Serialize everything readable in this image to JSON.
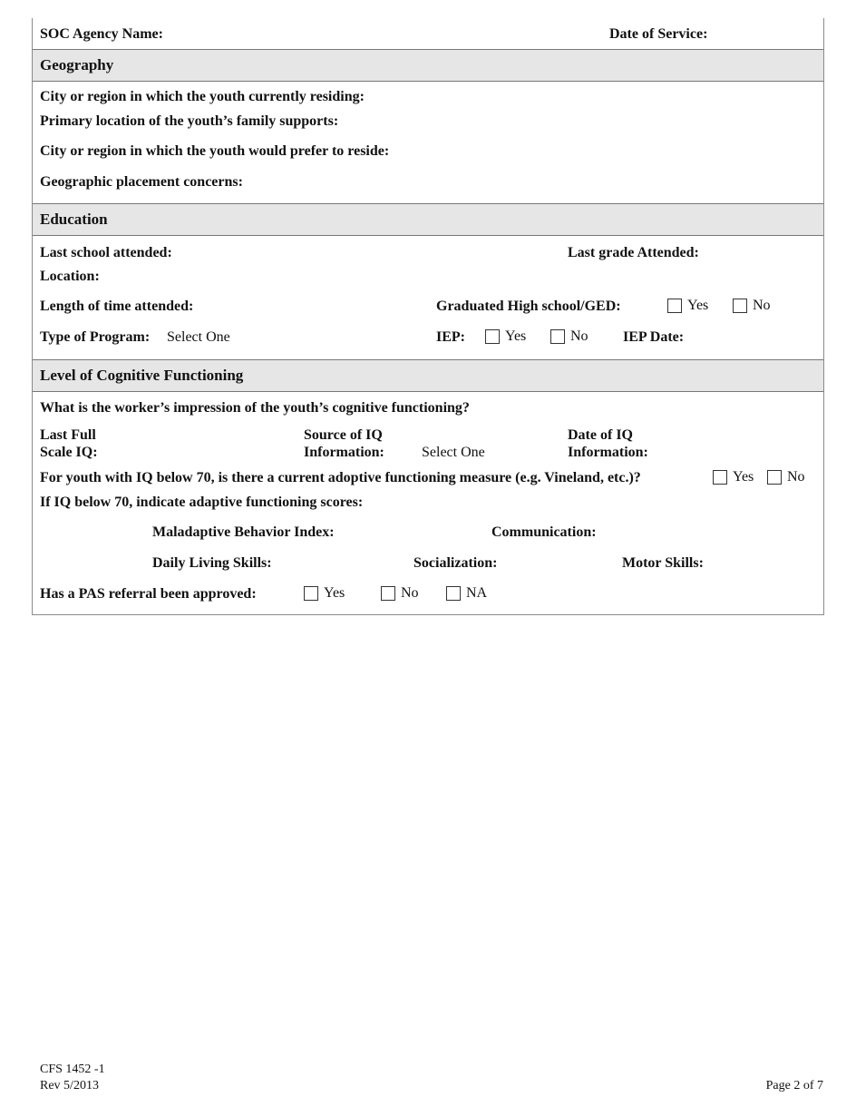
{
  "header": {
    "agency_label": "SOC Agency Name:",
    "date_label": "Date of Service:"
  },
  "geography": {
    "title": "Geography",
    "current_city": "City or region in which the youth currently residing:",
    "family_supports": "Primary location of the youth’s family supports:",
    "preferred_city": "City or region in which the youth would prefer to reside:",
    "placement_concerns": "Geographic placement concerns:"
  },
  "education": {
    "title": "Education",
    "last_school": "Last school attended:",
    "last_grade": "Last grade Attended:",
    "location": "Location:",
    "length_time": "Length of time attended:",
    "graduated": "Graduated High school/GED:",
    "graduated_options": [
      "Yes",
      "No"
    ],
    "program_label": "Type of Program:",
    "program_value": "Select One",
    "iep_label": "IEP:",
    "iep_options": [
      "Yes",
      "No"
    ],
    "iep_date": "IEP Date:"
  },
  "cognitive": {
    "title": "Level of Cognitive Functioning",
    "impression": "What is the worker’s impression of the youth’s cognitive functioning?",
    "full_scale_1": "Last Full",
    "full_scale_2": "Scale IQ:",
    "source_1": "Source of IQ",
    "source_2": "Information:",
    "source_value": "Select One",
    "date_1": "Date of IQ",
    "date_2": "Information:",
    "adaptive_question": "For youth with IQ below 70, is there a current adoptive functioning measure (e.g. Vineland, etc.)?",
    "adaptive_options": [
      "Yes",
      "No"
    ],
    "scores_label": "If IQ below 70, indicate adaptive functioning scores:",
    "maladaptive": "Maladaptive Behavior Index:",
    "communication": "Communication:",
    "daily_living": "Daily Living Skills:",
    "socialization": "Socialization:",
    "motor": "Motor Skills:",
    "pas_label": "Has a PAS referral been approved:",
    "pas_options": [
      "Yes",
      "No",
      "NA"
    ]
  },
  "footer": {
    "form_id": "CFS 1452 -1",
    "revision": "Rev 5/2013",
    "page": "Page 2 of 7"
  }
}
